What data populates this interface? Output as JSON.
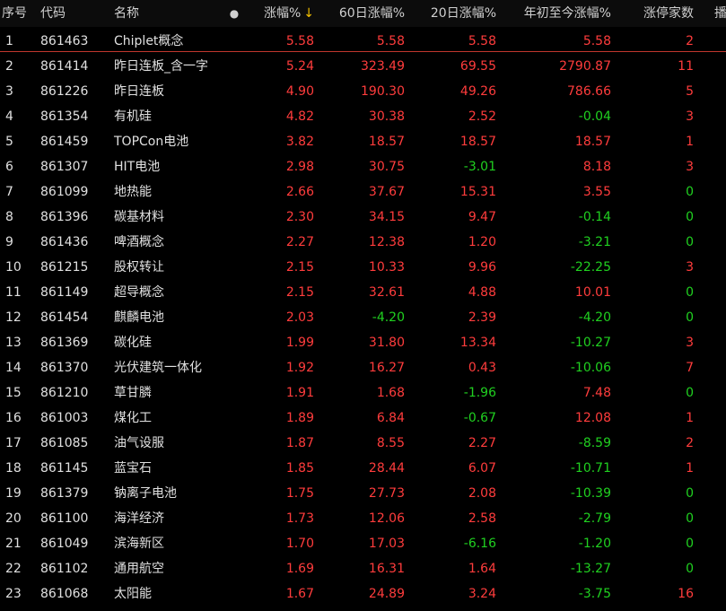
{
  "header": {
    "idx": "序号",
    "code": "代码",
    "name": "名称",
    "dot": "●",
    "pct": "涨幅%",
    "sort_arrow": "↓",
    "d60": "60日涨幅%",
    "d20": "20日涨幅%",
    "ytd": "年初至今涨幅%",
    "limit_up": "涨停家数",
    "more": "播"
  },
  "rows": [
    {
      "idx": "1",
      "code": "861463",
      "name": "Chiplet概念",
      "pct": "5.58",
      "d60": "5.58",
      "d20": "5.58",
      "ytd": "5.58",
      "limit_up": "2"
    },
    {
      "idx": "2",
      "code": "861414",
      "name": "昨日连板_含一字",
      "pct": "5.24",
      "d60": "323.49",
      "d20": "69.55",
      "ytd": "2790.87",
      "limit_up": "11"
    },
    {
      "idx": "3",
      "code": "861226",
      "name": "昨日连板",
      "pct": "4.90",
      "d60": "190.30",
      "d20": "49.26",
      "ytd": "786.66",
      "limit_up": "5"
    },
    {
      "idx": "4",
      "code": "861354",
      "name": "有机硅",
      "pct": "4.82",
      "d60": "30.38",
      "d20": "2.52",
      "ytd": "-0.04",
      "limit_up": "3"
    },
    {
      "idx": "5",
      "code": "861459",
      "name": "TOPCon电池",
      "pct": "3.82",
      "d60": "18.57",
      "d20": "18.57",
      "ytd": "18.57",
      "limit_up": "1"
    },
    {
      "idx": "6",
      "code": "861307",
      "name": "HIT电池",
      "pct": "2.98",
      "d60": "30.75",
      "d20": "-3.01",
      "ytd": "8.18",
      "limit_up": "3"
    },
    {
      "idx": "7",
      "code": "861099",
      "name": "地热能",
      "pct": "2.66",
      "d60": "37.67",
      "d20": "15.31",
      "ytd": "3.55",
      "limit_up": "0"
    },
    {
      "idx": "8",
      "code": "861396",
      "name": "碳基材料",
      "pct": "2.30",
      "d60": "34.15",
      "d20": "9.47",
      "ytd": "-0.14",
      "limit_up": "0"
    },
    {
      "idx": "9",
      "code": "861436",
      "name": "啤酒概念",
      "pct": "2.27",
      "d60": "12.38",
      "d20": "1.20",
      "ytd": "-3.21",
      "limit_up": "0"
    },
    {
      "idx": "10",
      "code": "861215",
      "name": "股权转让",
      "pct": "2.15",
      "d60": "10.33",
      "d20": "9.96",
      "ytd": "-22.25",
      "limit_up": "3"
    },
    {
      "idx": "11",
      "code": "861149",
      "name": "超导概念",
      "pct": "2.15",
      "d60": "32.61",
      "d20": "4.88",
      "ytd": "10.01",
      "limit_up": "0"
    },
    {
      "idx": "12",
      "code": "861454",
      "name": "麒麟电池",
      "pct": "2.03",
      "d60": "-4.20",
      "d20": "2.39",
      "ytd": "-4.20",
      "limit_up": "0"
    },
    {
      "idx": "13",
      "code": "861369",
      "name": "碳化硅",
      "pct": "1.99",
      "d60": "31.80",
      "d20": "13.34",
      "ytd": "-10.27",
      "limit_up": "3"
    },
    {
      "idx": "14",
      "code": "861370",
      "name": "光伏建筑一体化",
      "pct": "1.92",
      "d60": "16.27",
      "d20": "0.43",
      "ytd": "-10.06",
      "limit_up": "7"
    },
    {
      "idx": "15",
      "code": "861210",
      "name": "草甘膦",
      "pct": "1.91",
      "d60": "1.68",
      "d20": "-1.96",
      "ytd": "7.48",
      "limit_up": "0"
    },
    {
      "idx": "16",
      "code": "861003",
      "name": "煤化工",
      "pct": "1.89",
      "d60": "6.84",
      "d20": "-0.67",
      "ytd": "12.08",
      "limit_up": "1"
    },
    {
      "idx": "17",
      "code": "861085",
      "name": "油气设服",
      "pct": "1.87",
      "d60": "8.55",
      "d20": "2.27",
      "ytd": "-8.59",
      "limit_up": "2"
    },
    {
      "idx": "18",
      "code": "861145",
      "name": "蓝宝石",
      "pct": "1.85",
      "d60": "28.44",
      "d20": "6.07",
      "ytd": "-10.71",
      "limit_up": "1"
    },
    {
      "idx": "19",
      "code": "861379",
      "name": "钠离子电池",
      "pct": "1.75",
      "d60": "27.73",
      "d20": "2.08",
      "ytd": "-10.39",
      "limit_up": "0"
    },
    {
      "idx": "20",
      "code": "861100",
      "name": "海洋经济",
      "pct": "1.73",
      "d60": "12.06",
      "d20": "2.58",
      "ytd": "-2.79",
      "limit_up": "0"
    },
    {
      "idx": "21",
      "code": "861049",
      "name": "滨海新区",
      "pct": "1.70",
      "d60": "17.03",
      "d20": "-6.16",
      "ytd": "-1.20",
      "limit_up": "0"
    },
    {
      "idx": "22",
      "code": "861102",
      "name": "通用航空",
      "pct": "1.69",
      "d60": "16.31",
      "d20": "1.64",
      "ytd": "-13.27",
      "limit_up": "0"
    },
    {
      "idx": "23",
      "code": "861068",
      "name": "太阳能",
      "pct": "1.67",
      "d60": "24.89",
      "d20": "3.24",
      "ytd": "-3.75",
      "limit_up": "16"
    }
  ],
  "colors": {
    "up": "#ff3c3c",
    "down": "#20d020",
    "background": "#000000",
    "divider": "#c1362d",
    "sort_arrow": "#f3c000"
  }
}
